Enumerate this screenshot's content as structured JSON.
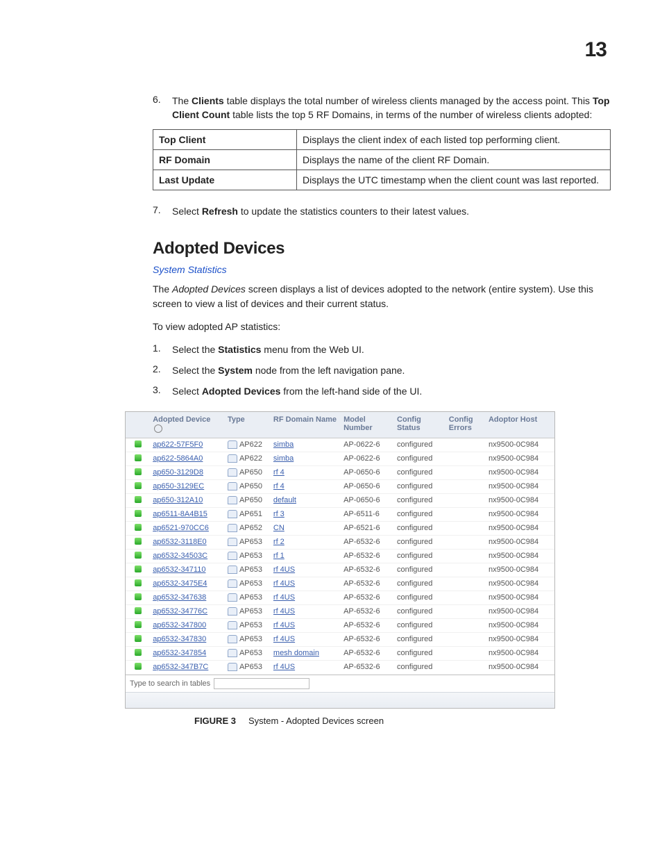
{
  "chapter_number": "13",
  "step6": {
    "num": "6.",
    "text_a": "The ",
    "b1": "Clients",
    "text_b": " table displays the total number of wireless clients managed by the access point. This ",
    "b2": "Top Client Count",
    "text_c": " table lists the top 5 RF Domains, in terms of the number of wireless clients adopted:"
  },
  "defs": [
    {
      "term": "Top Client",
      "desc": "Displays the client index of each listed top performing client."
    },
    {
      "term": "RF Domain",
      "desc": "Displays the name of the client RF Domain."
    },
    {
      "term": "Last Update",
      "desc": "Displays the UTC timestamp when the client count was last reported."
    }
  ],
  "step7": {
    "num": "7.",
    "text_a": "Select ",
    "b1": "Refresh",
    "text_b": " to update the statistics counters to their latest values."
  },
  "section_heading": "Adopted Devices",
  "breadcrumb": "System Statistics",
  "intro_a": "The ",
  "intro_em": "Adopted Devices",
  "intro_b": " screen displays a list of devices adopted to the network (entire system). Use this screen to view a list of devices and their current status.",
  "intro2": "To view adopted AP statistics:",
  "steps_inner": [
    {
      "num": "1.",
      "pre": "Select the ",
      "b": "Statistics",
      "post": " menu from the Web UI."
    },
    {
      "num": "2.",
      "pre": "Select the ",
      "b": "System",
      "post": " node from the left navigation pane."
    },
    {
      "num": "3.",
      "pre": "Select ",
      "b": "Adopted Devices",
      "post": " from the left-hand side of the UI."
    }
  ],
  "shot": {
    "headers": [
      "",
      "Adopted Device",
      "Type",
      "RF Domain Name",
      "Model Number",
      "Config Status",
      "Config Errors",
      "Adoptor Host"
    ],
    "rows": [
      {
        "dev": "ap622-57F5F0",
        "type": "AP622",
        "rf": "simba",
        "model": "AP-0622-6",
        "cfg": "configured",
        "err": "",
        "host": "nx9500-0C984"
      },
      {
        "dev": "ap622-5864A0",
        "type": "AP622",
        "rf": "simba",
        "model": "AP-0622-6",
        "cfg": "configured",
        "err": "",
        "host": "nx9500-0C984"
      },
      {
        "dev": "ap650-3129D8",
        "type": "AP650",
        "rf": "rf 4",
        "model": "AP-0650-6",
        "cfg": "configured",
        "err": "",
        "host": "nx9500-0C984"
      },
      {
        "dev": "ap650-3129EC",
        "type": "AP650",
        "rf": "rf 4",
        "model": "AP-0650-6",
        "cfg": "configured",
        "err": "",
        "host": "nx9500-0C984"
      },
      {
        "dev": "ap650-312A10",
        "type": "AP650",
        "rf": "default",
        "model": "AP-0650-6",
        "cfg": "configured",
        "err": "",
        "host": "nx9500-0C984"
      },
      {
        "dev": "ap6511-8A4B15",
        "type": "AP651",
        "rf": "rf 3",
        "model": "AP-6511-6",
        "cfg": "configured",
        "err": "",
        "host": "nx9500-0C984"
      },
      {
        "dev": "ap6521-970CC6",
        "type": "AP652",
        "rf": "CN",
        "model": "AP-6521-6",
        "cfg": "configured",
        "err": "",
        "host": "nx9500-0C984"
      },
      {
        "dev": "ap6532-3118E0",
        "type": "AP653",
        "rf": "rf 2",
        "model": "AP-6532-6",
        "cfg": "configured",
        "err": "",
        "host": "nx9500-0C984"
      },
      {
        "dev": "ap6532-34503C",
        "type": "AP653",
        "rf": "rf 1",
        "model": "AP-6532-6",
        "cfg": "configured",
        "err": "",
        "host": "nx9500-0C984"
      },
      {
        "dev": "ap6532-347110",
        "type": "AP653",
        "rf": "rf 4US",
        "model": "AP-6532-6",
        "cfg": "configured",
        "err": "",
        "host": "nx9500-0C984"
      },
      {
        "dev": "ap6532-3475E4",
        "type": "AP653",
        "rf": "rf 4US",
        "model": "AP-6532-6",
        "cfg": "configured",
        "err": "",
        "host": "nx9500-0C984"
      },
      {
        "dev": "ap6532-347638",
        "type": "AP653",
        "rf": "rf 4US",
        "model": "AP-6532-6",
        "cfg": "configured",
        "err": "",
        "host": "nx9500-0C984"
      },
      {
        "dev": "ap6532-34776C",
        "type": "AP653",
        "rf": "rf 4US",
        "model": "AP-6532-6",
        "cfg": "configured",
        "err": "",
        "host": "nx9500-0C984"
      },
      {
        "dev": "ap6532-347800",
        "type": "AP653",
        "rf": "rf 4US",
        "model": "AP-6532-6",
        "cfg": "configured",
        "err": "",
        "host": "nx9500-0C984"
      },
      {
        "dev": "ap6532-347830",
        "type": "AP653",
        "rf": "rf 4US",
        "model": "AP-6532-6",
        "cfg": "configured",
        "err": "",
        "host": "nx9500-0C984"
      },
      {
        "dev": "ap6532-347854",
        "type": "AP653",
        "rf": "mesh domain",
        "model": "AP-6532-6",
        "cfg": "configured",
        "err": "",
        "host": "nx9500-0C984"
      },
      {
        "dev": "ap6532-347B7C",
        "type": "AP653",
        "rf": "rf 4US",
        "model": "AP-6532-6",
        "cfg": "configured",
        "err": "",
        "host": "nx9500-0C984"
      }
    ],
    "search_label": "Type to search in tables"
  },
  "figure": {
    "label": "FIGURE 3",
    "caption": "System - Adopted Devices screen"
  }
}
